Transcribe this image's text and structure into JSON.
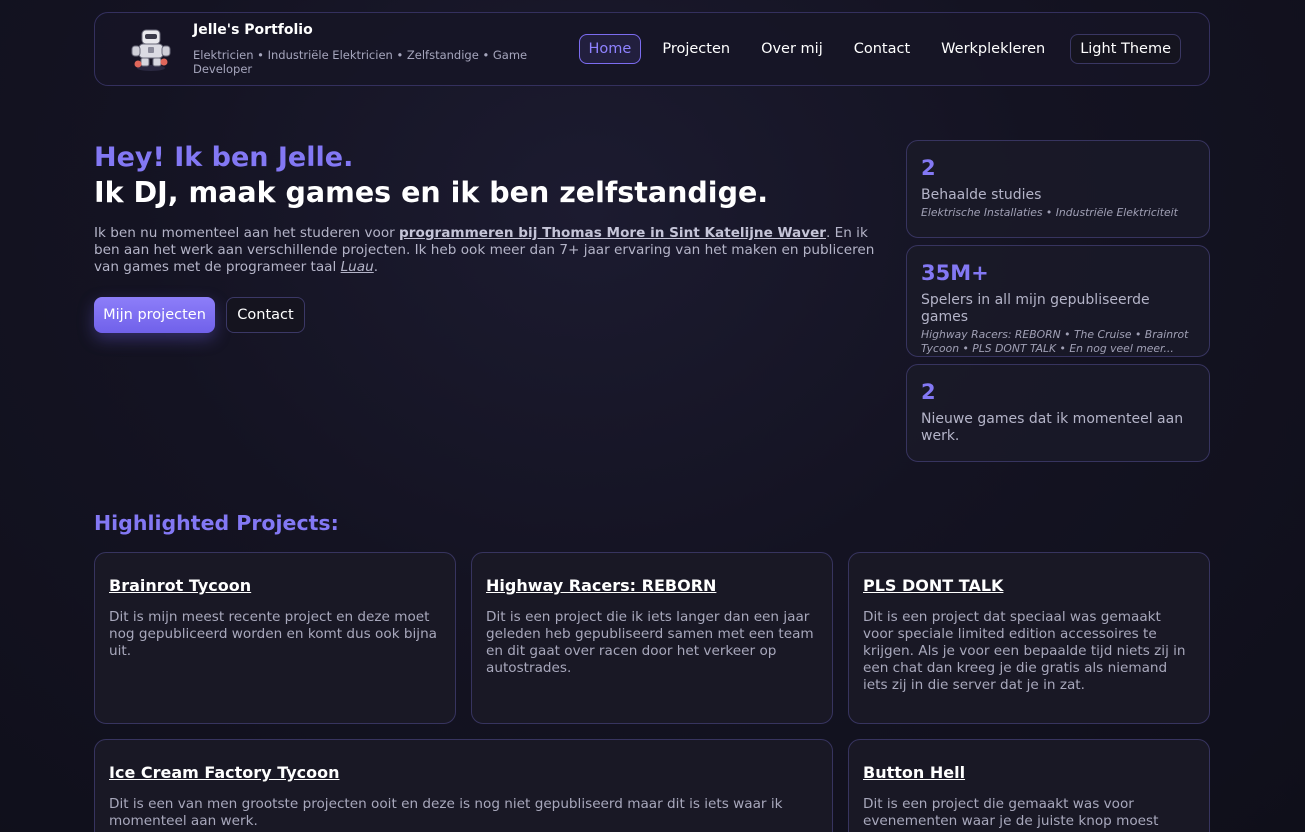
{
  "nav": {
    "logo_icon": "robot-mascot-icon",
    "title": "Jelle's Portfolio",
    "subtitle": "Elektricien • Industriële Elektricien • Zelfstandige • Game Developer",
    "links": [
      "Home",
      "Projecten",
      "Over mij",
      "Contact",
      "Werkplekleren"
    ],
    "active": "Home",
    "theme_toggle": "Light Theme"
  },
  "hero": {
    "greeting": "Hey! Ik ben Jelle.",
    "headline": "Ik DJ, maak games en ik ben zelfstandige.",
    "intro_1": "Ik ben nu momenteel aan het studeren voor ",
    "intro_link": "programmeren bij Thomas More in Sint Katelijne Waver",
    "intro_2": ". En ik ben aan het werk aan verschillende projecten. Ik heb ook meer dan 7+ jaar ervaring van het maken en publiceren van games met de programeer taal ",
    "intro_lang": "Luau",
    "intro_3": ".",
    "primary_button": "Mijn projecten",
    "secondary_button": "Contact"
  },
  "stats": [
    {
      "value": "2",
      "label": "Behaalde studies",
      "detail": "Elektrische Installaties • Industriële Elektriciteit"
    },
    {
      "value": "35M+",
      "label": "Spelers in all mijn gepubliseerde games",
      "detail": "Highway Racers: REBORN • The Cruise • Brainrot Tycoon • PLS DONT TALK • En nog veel meer..."
    },
    {
      "value": "2",
      "label": "Nieuwe games dat ik momenteel aan werk.",
      "detail": ""
    }
  ],
  "projects": {
    "heading": "Highlighted Projects:",
    "items": [
      {
        "title": "Brainrot Tycoon",
        "desc": "Dit is mijn meest recente project en deze moet nog gepubliceerd worden en komt dus ook bijna uit."
      },
      {
        "title": "Highway Racers: REBORN",
        "desc": "Dit is een project die ik iets langer dan een jaar geleden heb gepubliseerd samen met een team en dit gaat over racen door het verkeer op autostrades."
      },
      {
        "title": "PLS DONT TALK",
        "desc": "Dit is een project dat speciaal was gemaakt voor speciale limited edition accessoires te krijgen. Als je voor een bepaalde tijd niets zij in een chat dan kreeg je die gratis als niemand iets zij in die server dat je in zat."
      },
      {
        "title": "Ice Cream Factory Tycoon",
        "desc": "Dit is een van men grootste projecten ooit en deze is nog niet gepubliseerd maar dit is iets waar ik momenteel aan werk."
      },
      {
        "title": "Button Hell",
        "desc": "Dit is een project die gemaakt was voor evenementen waar je de juiste knop moest"
      }
    ]
  },
  "colors": {
    "accent": "#8378f4",
    "background": "#141322",
    "card_border": "#37345f"
  }
}
